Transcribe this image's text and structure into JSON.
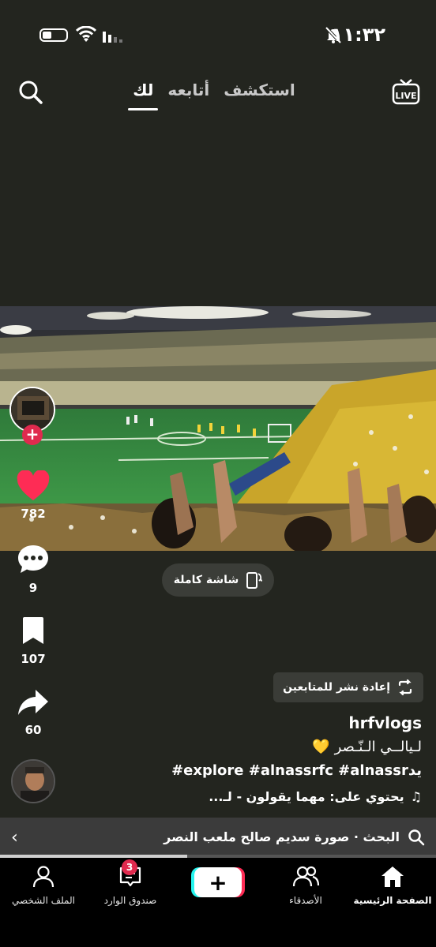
{
  "status_bar": {
    "time": "١١:٣٢"
  },
  "top_nav": {
    "tabs": [
      {
        "label": "استكشف"
      },
      {
        "label": "أتابعه"
      },
      {
        "label": "لك"
      }
    ]
  },
  "fullscreen": {
    "label": "شاشة كاملة"
  },
  "actions": {
    "likes": "782",
    "comments": "9",
    "saves": "107",
    "shares": "60"
  },
  "post": {
    "repost_label": "إعادة نشر للمتابعين",
    "username": "hrfvlogs",
    "caption_line1": "لـيالــي الـنّـصر",
    "caption_emoji": "💛",
    "caption_line2": "#explore #alnassrfc #alnassrيد",
    "sound": "يحتوي على: مهما يقولون - لـ..."
  },
  "search_strip": {
    "text": "البحث · صورة سديم صالح ملعب النصر"
  },
  "video_progress": 0.43,
  "bottom_nav": {
    "home": "الصفحة الرئيسية",
    "friends": "الأصدقاء",
    "inbox": "صندوق الوارد",
    "inbox_badge": "3",
    "profile": "الملف الشخصي"
  },
  "colors": {
    "accent_red": "#e02a4e",
    "cyan": "#25f4ee",
    "pink": "#fe2c55"
  }
}
